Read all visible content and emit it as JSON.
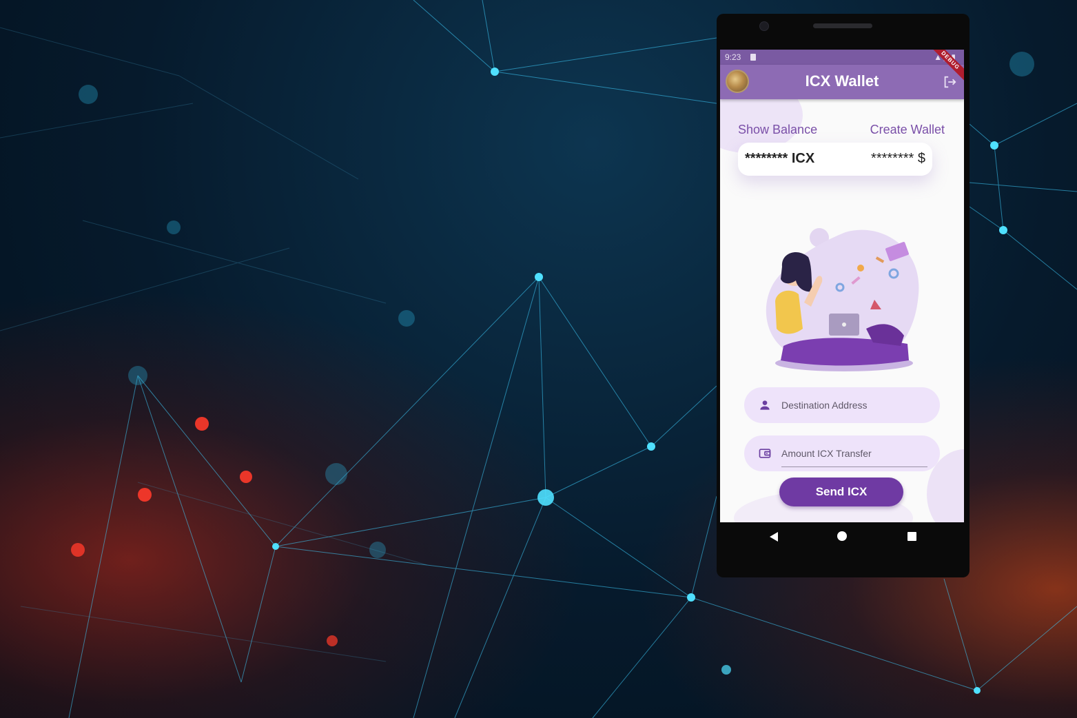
{
  "status_bar": {
    "time": "9:23"
  },
  "app_bar": {
    "title": "ICX Wallet",
    "debug_label": "DEBUG"
  },
  "links": {
    "show_balance": "Show Balance",
    "create_wallet": "Create Wallet"
  },
  "balance": {
    "icx": "******** ICX",
    "usd": "******** $"
  },
  "form": {
    "destination_placeholder": "Destination Address",
    "amount_placeholder": "Amount ICX Transfer",
    "send_label": "Send ICX"
  },
  "colors": {
    "app_bar": "#8d6bb4",
    "accent": "#7a4fa8",
    "button": "#6f3aa3",
    "field_bg": "#eee3fa"
  },
  "icons": {
    "logout": "logout-icon",
    "person": "person-icon",
    "wallet": "wallet-icon",
    "back": "back-icon",
    "home": "home-icon",
    "recents": "recents-icon"
  }
}
